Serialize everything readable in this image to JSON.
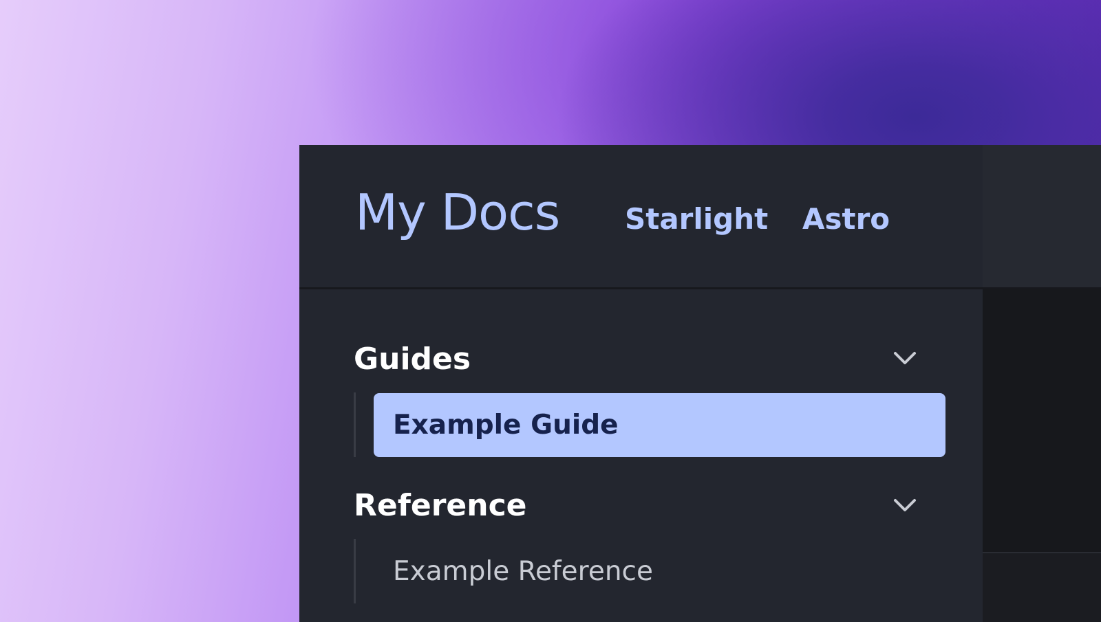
{
  "header": {
    "site_title": "My Docs",
    "nav_links": [
      {
        "label": "Starlight"
      },
      {
        "label": "Astro"
      }
    ]
  },
  "sidebar": {
    "groups": [
      {
        "label": "Guides",
        "expanded": true,
        "items": [
          {
            "label": "Example Guide",
            "active": true
          }
        ]
      },
      {
        "label": "Reference",
        "expanded": true,
        "items": [
          {
            "label": "Example Reference",
            "active": false
          }
        ]
      }
    ]
  },
  "icons": {
    "group_toggle": "chevron-down-icon"
  },
  "colors": {
    "accent": "#b3c7ff",
    "accent_text": "#16224d",
    "panel_background": "#23262f",
    "content_background": "#17181c",
    "heading_text": "#ffffff",
    "muted_text": "#c9ccd4"
  }
}
